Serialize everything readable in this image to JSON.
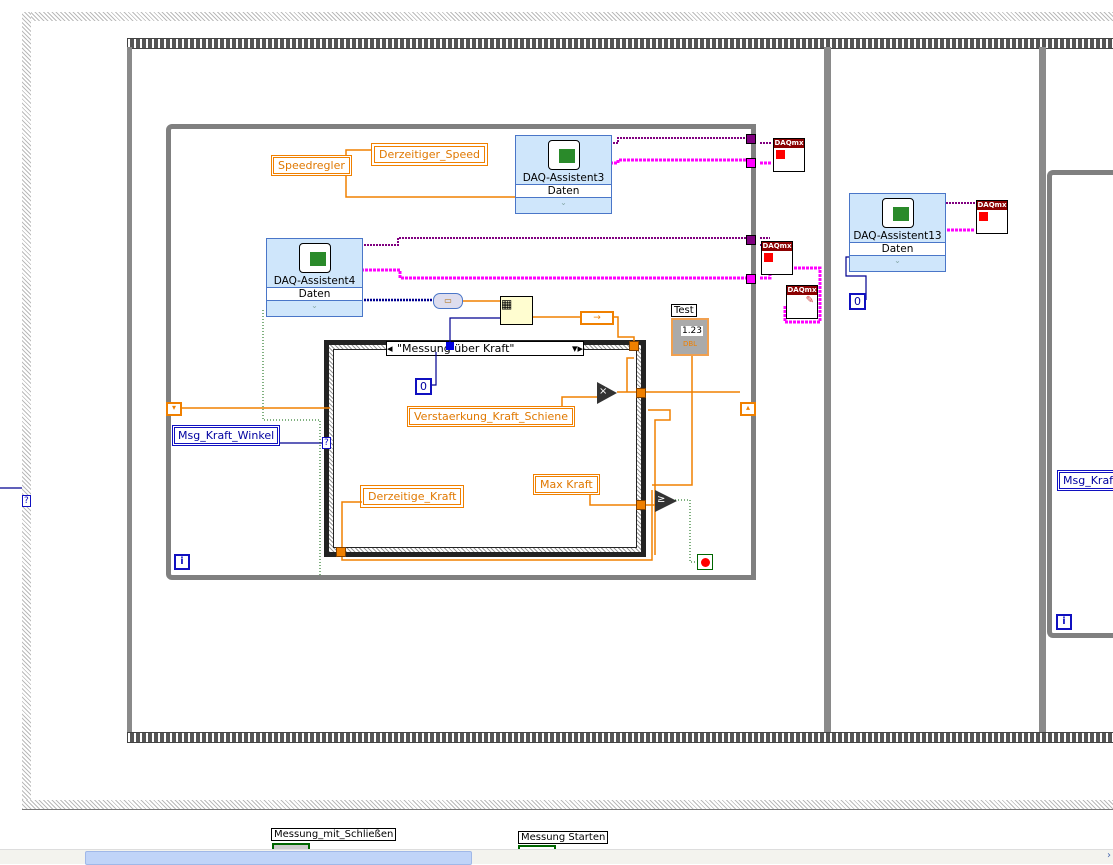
{
  "diagram": {
    "daq_assistants": [
      {
        "name": "DAQ-Assistent3",
        "output": "Daten"
      },
      {
        "name": "DAQ-Assistent4",
        "output": "Daten"
      },
      {
        "name": "DAQ-Assistent13",
        "output": "Daten"
      }
    ],
    "daqmx_label": "DAQmx",
    "controls": {
      "speedregler": "Speedregler",
      "verstaerkung": "Verstaerkung_Kraft_Schiene",
      "max_kraft": "Max Kraft",
      "msg_kraft_winkel": "Msg_Kraft_Winkel",
      "msg_kraft_right": "Msg_Kraft"
    },
    "indicators": {
      "derzeitiger_speed": "Derzeitiger_Speed",
      "derzeitige_kraft": "Derzeitige_Kraft"
    },
    "test_indicator": {
      "label": "Test",
      "value": "1.23",
      "type": "DBL"
    },
    "case_selector": "\"Messung über Kraft\"",
    "constants": [
      "0",
      "0"
    ],
    "iteration_terminal": "i",
    "unknown_terminal": "?",
    "multiply_symbol": "×",
    "compare_symbol": "≥",
    "bottom_labels": [
      "Messung_mit_Schließen",
      "Messung Starten"
    ],
    "colors": {
      "orange_wire": "#f08000",
      "pink_wire": "#ff00ff",
      "purple_wire": "#800080",
      "blue_wire": "#000090",
      "loop_border": "#808080"
    }
  }
}
